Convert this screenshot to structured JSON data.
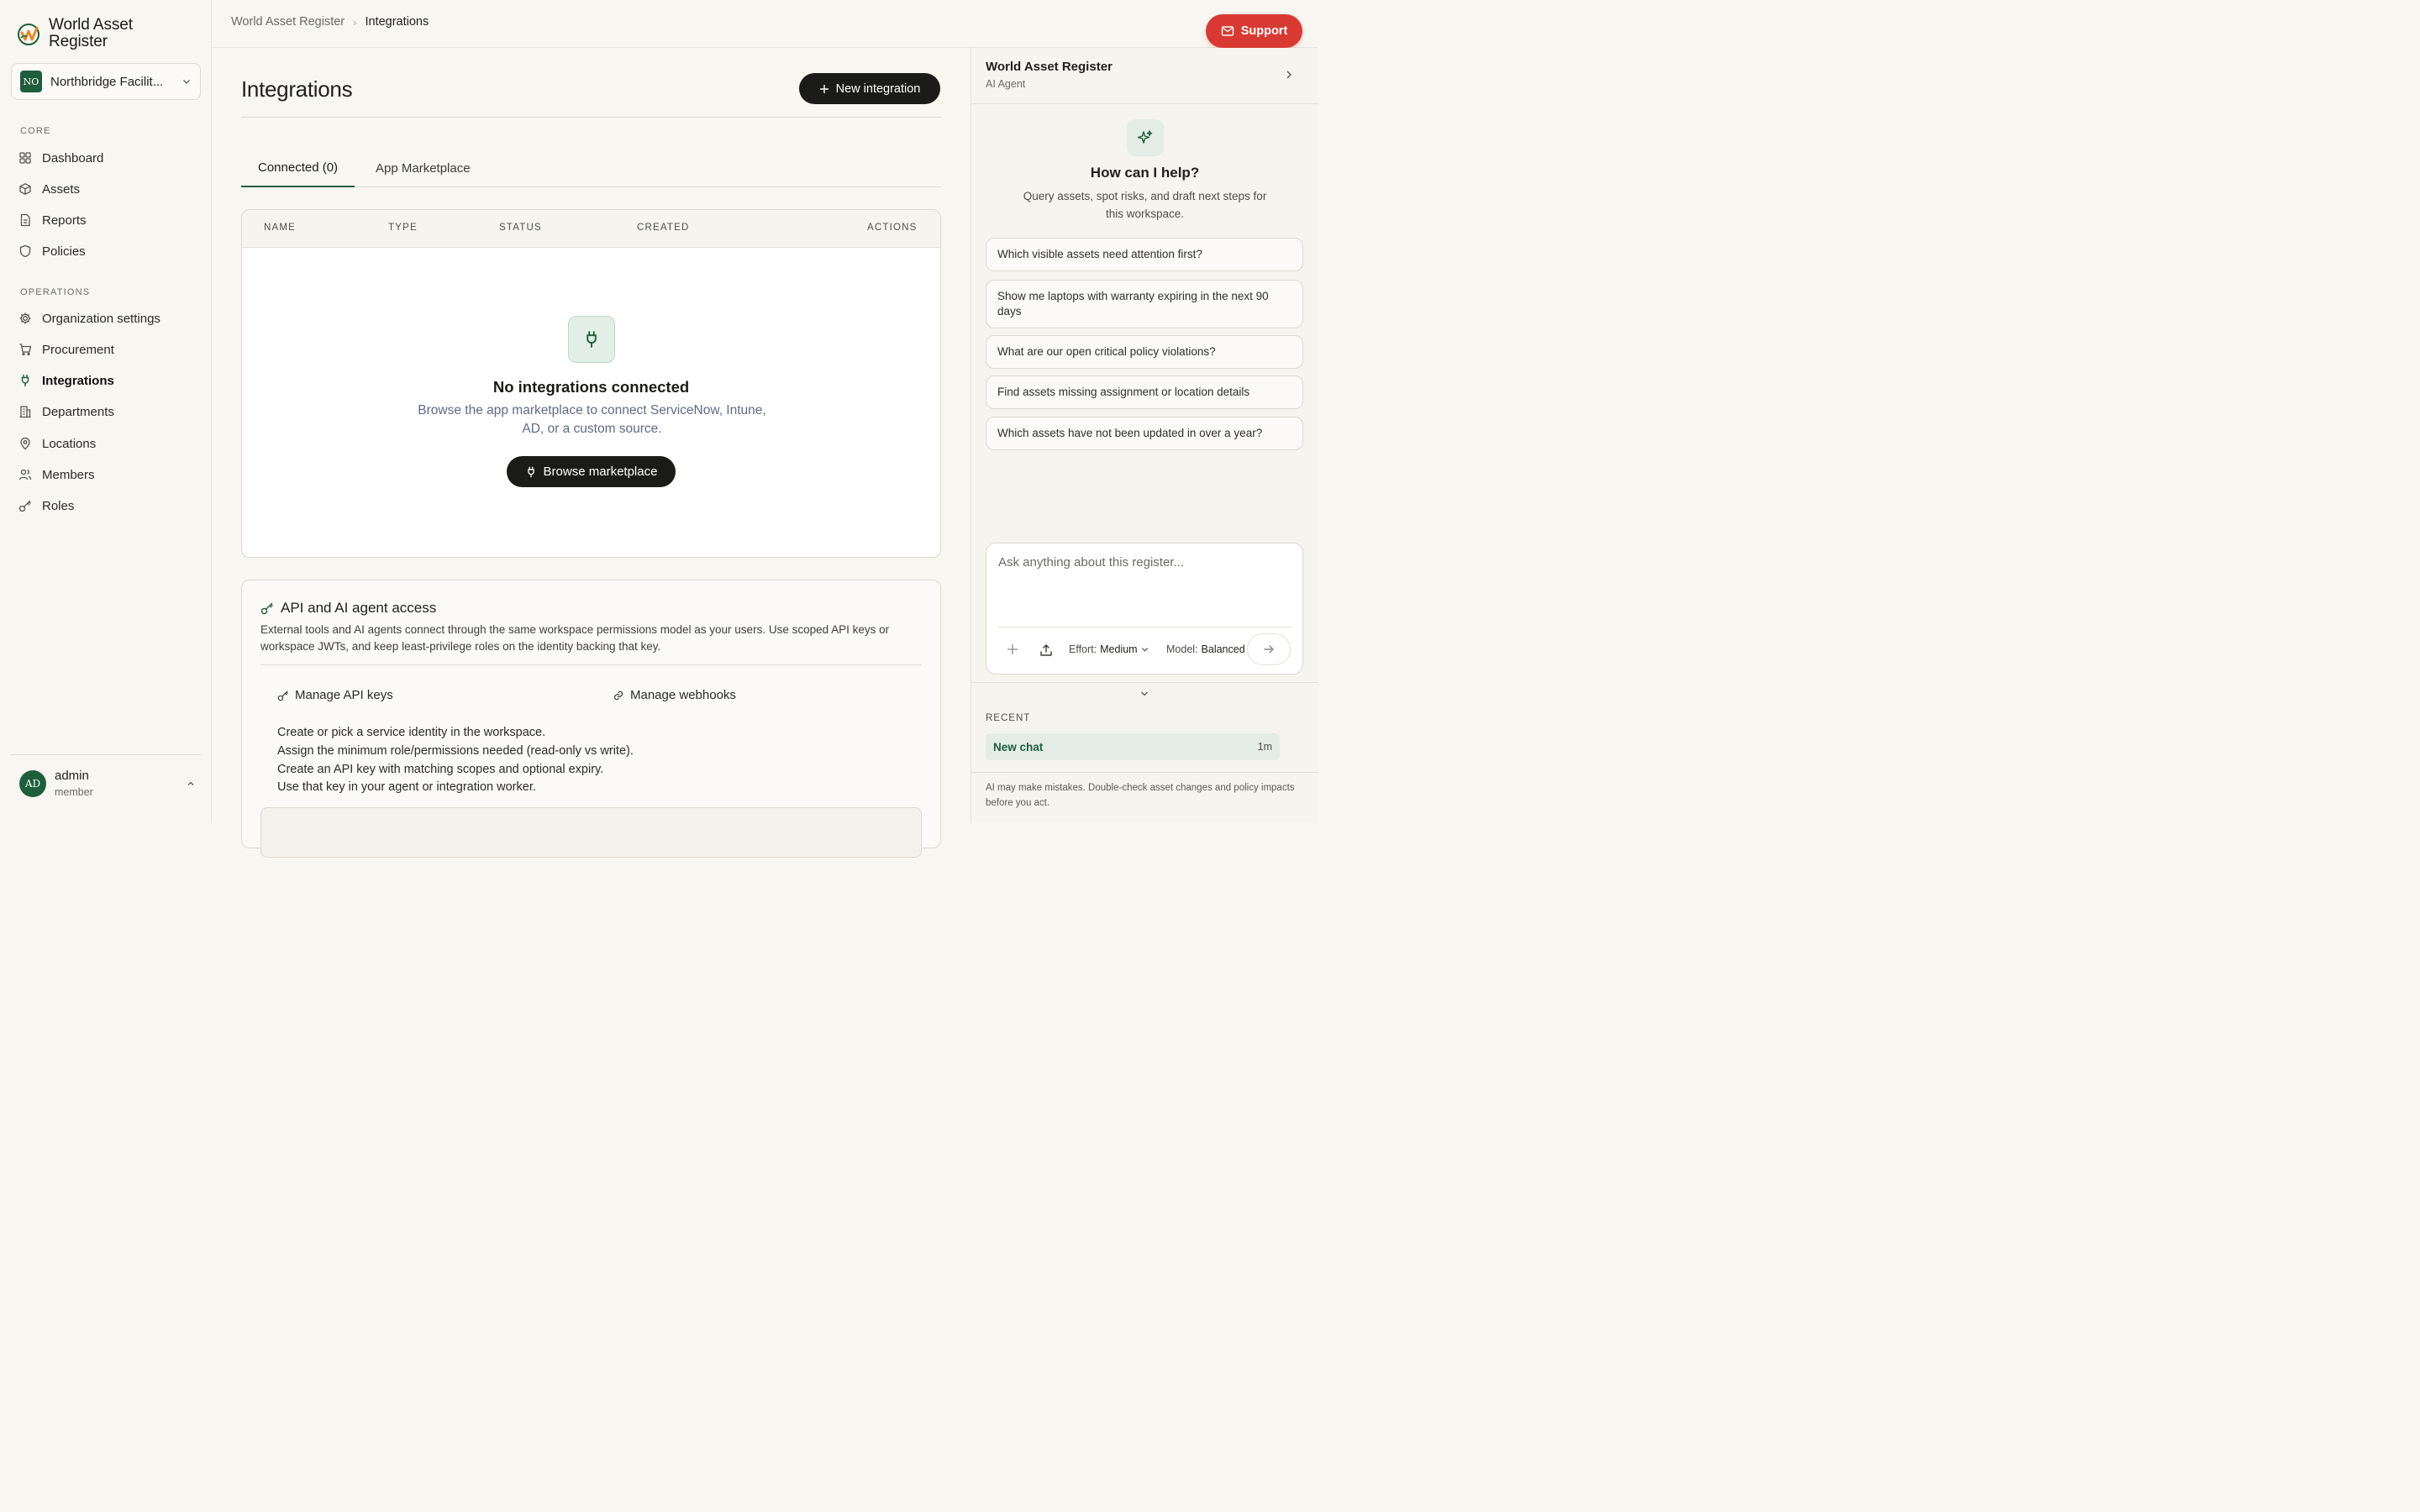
{
  "brand": {
    "name": "World Asset Register"
  },
  "org": {
    "initials": "NO",
    "name": "Northbridge Facilit..."
  },
  "sidebar": {
    "core_label": "CORE",
    "core_items": [
      {
        "label": "Dashboard",
        "icon": "grid-icon"
      },
      {
        "label": "Assets",
        "icon": "box-icon"
      },
      {
        "label": "Reports",
        "icon": "document-icon"
      },
      {
        "label": "Policies",
        "icon": "shield-icon"
      }
    ],
    "ops_label": "OPERATIONS",
    "ops_items": [
      {
        "label": "Organization settings",
        "icon": "gear-icon"
      },
      {
        "label": "Procurement",
        "icon": "cart-icon"
      },
      {
        "label": "Integrations",
        "icon": "plug-icon",
        "active": true
      },
      {
        "label": "Departments",
        "icon": "building-icon"
      },
      {
        "label": "Locations",
        "icon": "pin-icon"
      },
      {
        "label": "Members",
        "icon": "users-icon"
      },
      {
        "label": "Roles",
        "icon": "key-icon"
      }
    ]
  },
  "user": {
    "initials": "AD",
    "name": "admin",
    "role": "member"
  },
  "breadcrumb": {
    "root": "World Asset Register",
    "sep": "›",
    "current": "Integrations"
  },
  "support": {
    "label": "Support"
  },
  "page": {
    "title": "Integrations",
    "new_button": "New integration"
  },
  "tabs": [
    {
      "label": "Connected (0)",
      "active": true
    },
    {
      "label": "App Marketplace",
      "active": false
    }
  ],
  "table": {
    "columns": [
      "NAME",
      "TYPE",
      "STATUS",
      "CREATED",
      "ACTIONS"
    ],
    "empty_title": "No integrations connected",
    "empty_desc": "Browse the app marketplace to connect ServiceNow, Intune, AD, or a custom source.",
    "browse_button": "Browse marketplace"
  },
  "api": {
    "title": "API and AI agent access",
    "desc": "External tools and AI agents connect through the same workspace permissions model as your users. Use scoped API keys or workspace JWTs, and keep least-privilege roles on the identity backing that key.",
    "manage_keys": "Manage API keys",
    "manage_webhooks": "Manage webhooks",
    "steps": [
      "Create or pick a service identity in the workspace.",
      "Assign the minimum role/permissions needed (read-only vs write).",
      "Create an API key with matching scopes and optional expiry.",
      "Use that key in your agent or integration worker."
    ]
  },
  "agent": {
    "title": "World Asset Register",
    "subtitle": "AI Agent",
    "help_title": "How can I help?",
    "help_desc": "Query assets, spot risks, and draft next steps for this workspace.",
    "suggestions": [
      "Which visible assets need attention first?",
      "Show me laptops with warranty expiring in the next 90 days",
      "What are our open critical policy violations?",
      "Find assets missing assignment or location details",
      "Which assets have not been updated in over a year?"
    ],
    "input_placeholder": "Ask anything about this register...",
    "effort_label": "Effort:",
    "effort_value": "Medium",
    "model_label": "Model:",
    "model_value": "Balanced",
    "recent_label": "RECENT",
    "recent_item": "New chat",
    "recent_time": "1m",
    "disclaimer": "AI may make mistakes. Double-check asset changes and policy impacts before you act."
  },
  "colors": {
    "brand_green": "#1f5e3d",
    "support_red": "#d83a33",
    "dark_button": "#1b1b19"
  }
}
